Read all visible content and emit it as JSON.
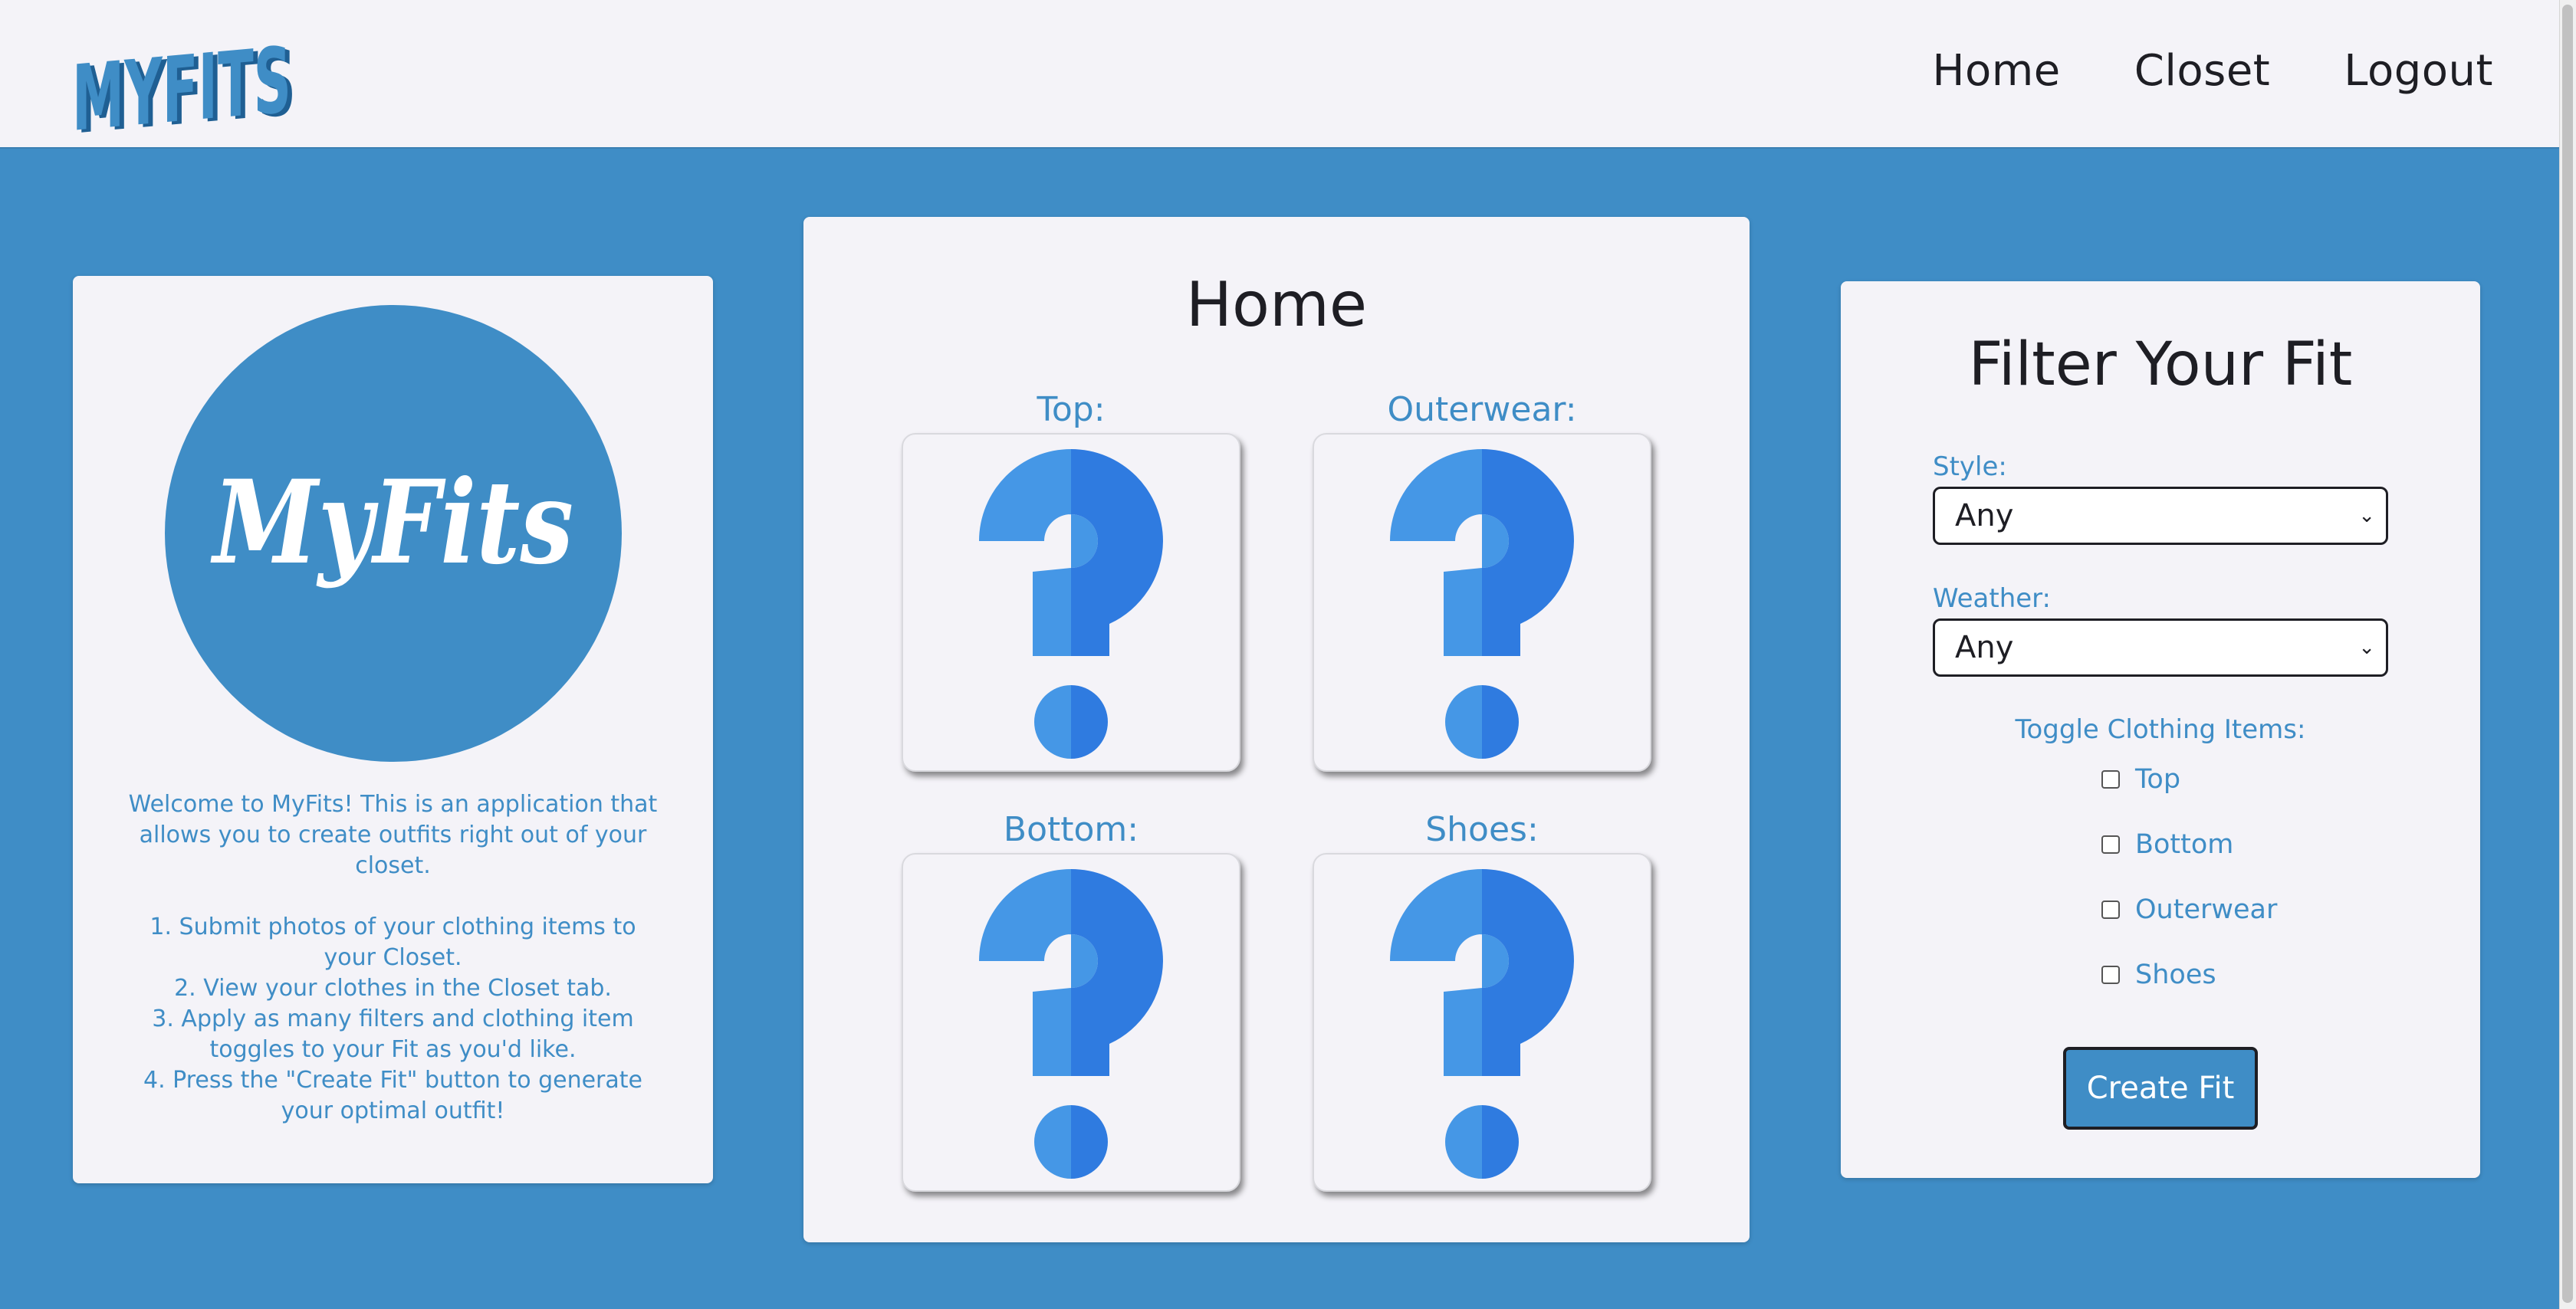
{
  "brand": {
    "logo_text": "MYFITS",
    "badge_text": "MyFits"
  },
  "nav": {
    "home": "Home",
    "closet": "Closet",
    "logout": "Logout"
  },
  "welcome": {
    "intro": "Welcome to MyFits! This is an application that allows you to create outfits right out of your closet.",
    "steps": [
      "1. Submit photos of your clothing items to your Closet.",
      "2. View your clothes in the Closet tab.",
      "3. Apply as many filters and clothing item toggles to your Fit as you'd like.",
      "4. Press the \"Create Fit\" button to generate your optimal outfit!"
    ]
  },
  "home": {
    "title": "Home",
    "slots": {
      "top": "Top:",
      "outerwear": "Outerwear:",
      "bottom": "Bottom:",
      "shoes": "Shoes:"
    }
  },
  "filter": {
    "title": "Filter Your Fit",
    "style_label": "Style:",
    "style_value": "Any",
    "weather_label": "Weather:",
    "weather_value": "Any",
    "toggle_title": "Toggle Clothing Items:",
    "toggles": [
      "Top",
      "Bottom",
      "Outerwear",
      "Shoes"
    ],
    "button": "Create Fit"
  },
  "colors": {
    "brand_blue": "#3f8dc6",
    "card_bg": "#f4f3f8",
    "question_light": "#4597e6",
    "question_dark": "#2f7be0"
  }
}
